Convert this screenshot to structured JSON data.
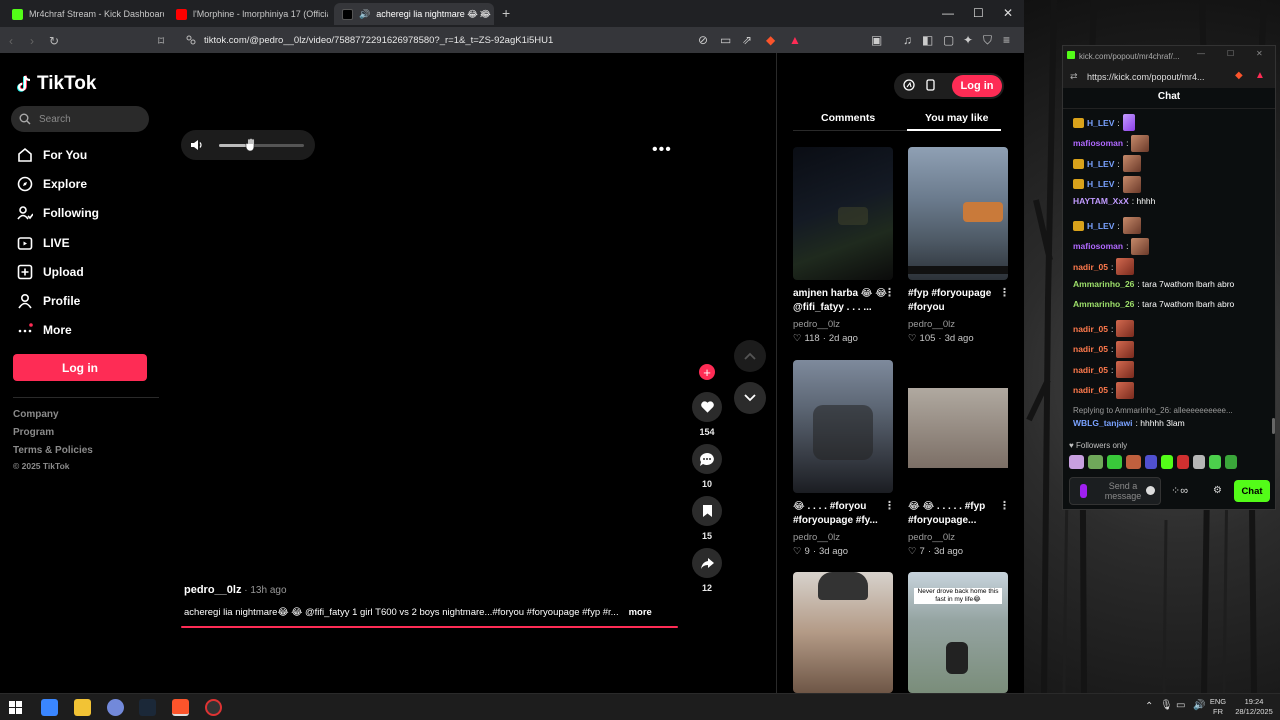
{
  "browser": {
    "tabs": [
      {
        "title": "Mr4chraf Stream - Kick Dashboard"
      },
      {
        "title": "l'Morphine - lmorphiniya 17 (Official"
      },
      {
        "title": "acheregi lia nightmare 😂 😂"
      }
    ],
    "url": "tiktok.com/@pedro__0lz/video/7588772291626978580?_r=1&_t=ZS-92agK1i5HU1"
  },
  "tiktok": {
    "logo": "TikTok",
    "search_placeholder": "Search",
    "nav": [
      {
        "label": "For You",
        "icon": "home-icon"
      },
      {
        "label": "Explore",
        "icon": "compass-icon"
      },
      {
        "label": "Following",
        "icon": "following-icon"
      },
      {
        "label": "LIVE",
        "icon": "live-icon"
      },
      {
        "label": "Upload",
        "icon": "upload-icon"
      },
      {
        "label": "Profile",
        "icon": "profile-icon"
      },
      {
        "label": "More",
        "icon": "more-dots-icon"
      }
    ],
    "login_label": "Log in",
    "footer": {
      "company": "Company",
      "program": "Program",
      "terms": "Terms & Policies",
      "copyright": "© 2025 TikTok"
    },
    "volume_level": 0.37,
    "video": {
      "author": "pedro__0lz",
      "time_ago": " · 13h ago",
      "caption": "acheregi lia nightmare😂 😂 @fifi_fatyy 1 girl T600 vs 2 boys nightmare...#foryou #foryoupage #fyp #r...",
      "more": "more",
      "likes": "154",
      "comments": "10",
      "saves": "15",
      "shares": "12"
    },
    "right": {
      "login_label": "Log in",
      "tabs": [
        "Comments",
        "You may like"
      ],
      "cards": [
        {
          "title": "amjnen harba 😂 😂@fifi_fatyy . . . ...",
          "author": "pedro__0lz",
          "likes": "118",
          "age": "2d ago"
        },
        {
          "title": "#fyp #foryoupage #foryou",
          "author": "pedro__0lz",
          "likes": "105",
          "age": "3d ago"
        },
        {
          "title": "😂 . . . . #foryou #foryoupage #fy...",
          "author": "pedro__0lz",
          "likes": "9",
          "age": "3d ago"
        },
        {
          "title": "😂 😂 . . . . . #fyp #foryoupage...",
          "author": "pedro__0lz",
          "likes": "7",
          "age": "3d ago"
        }
      ],
      "thumb_text": "Never drove back home this fast in my life😂"
    }
  },
  "kick": {
    "window_title": "kick.com/popout/mr4chraf/...",
    "url": "https://kick.com/popout/mr4...",
    "header": "Chat",
    "messages": [
      {
        "user": "H_LEV",
        "color": "#7aa2ff",
        "text": ":",
        "emote": "purple",
        "crown": true
      },
      {
        "user": "mafiosoman",
        "color": "#b069ff",
        "text": ":",
        "emote": "face",
        "crown": false
      },
      {
        "user": "H_LEV",
        "color": "#7aa2ff",
        "text": ":",
        "emote": "face",
        "crown": true
      },
      {
        "user": "H_LEV",
        "color": "#7aa2ff",
        "text": ":",
        "emote": "face",
        "crown": true
      },
      {
        "user": "HAYTAM_XxX",
        "color": "#c19bff",
        "text": ": hhhh",
        "emote": "",
        "crown": false
      },
      {
        "user": "H_LEV",
        "color": "#7aa2ff",
        "text": ":",
        "emote": "face",
        "crown": true
      },
      {
        "user": "mafiosoman",
        "color": "#b069ff",
        "text": ":",
        "emote": "face",
        "crown": false
      },
      {
        "user": "nadir_05",
        "color": "#ff7a4d",
        "text": ":",
        "emote": "red",
        "crown": false
      },
      {
        "user": "Ammarinho_26",
        "color": "#9ee06b",
        "text": ": tara 7wathom lbarh abro",
        "emote": "",
        "crown": false
      },
      {
        "user": "Ammarinho_26",
        "color": "#9ee06b",
        "text": ": tara 7wathom lbarh abro",
        "emote": "",
        "crown": false
      },
      {
        "user": "nadir_05",
        "color": "#ff7a4d",
        "text": ":",
        "emote": "red",
        "crown": false
      },
      {
        "user": "nadir_05",
        "color": "#ff7a4d",
        "text": ":",
        "emote": "red",
        "crown": false
      },
      {
        "user": "nadir_05",
        "color": "#ff7a4d",
        "text": ":",
        "emote": "red",
        "crown": false
      },
      {
        "user": "nadir_05",
        "color": "#ff7a4d",
        "text": ":",
        "emote": "red",
        "crown": false
      }
    ],
    "reply_to": "Replying to Ammarinho_26: alleeeeeeeeee...",
    "reply_msg": {
      "user": "WBLG_tanjawi",
      "text": ": hhhhh 3lam"
    },
    "followers_only": "Followers only",
    "send_placeholder": "Send a message",
    "chat_button": "Chat"
  },
  "taskbar": {
    "lang1": "ENG",
    "lang2": "FR",
    "time": "19:24",
    "date": "28/12/2025"
  },
  "colors": {
    "tiktok_red": "#fe2c55",
    "kick_green": "#53fc18"
  }
}
